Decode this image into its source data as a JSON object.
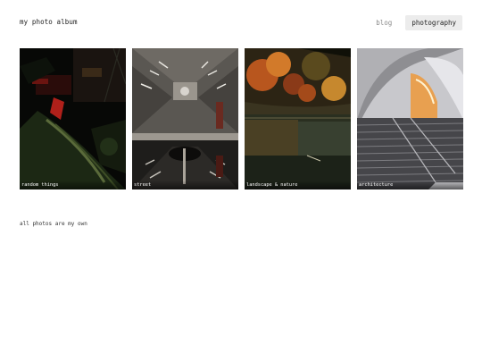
{
  "header": {
    "site_title": "my photo album",
    "nav": [
      {
        "label": "blog",
        "active": false
      },
      {
        "label": "photography",
        "active": true
      }
    ]
  },
  "gallery": {
    "items": [
      {
        "caption": "random things"
      },
      {
        "caption": "street"
      },
      {
        "caption": "landscape & nature"
      },
      {
        "caption": "architecture"
      }
    ]
  },
  "footer": {
    "note": "all photos are my own"
  },
  "colors": {
    "nav_active_bg": "#ececec",
    "text": "#1e1e1e",
    "muted": "#8a8a8a"
  }
}
